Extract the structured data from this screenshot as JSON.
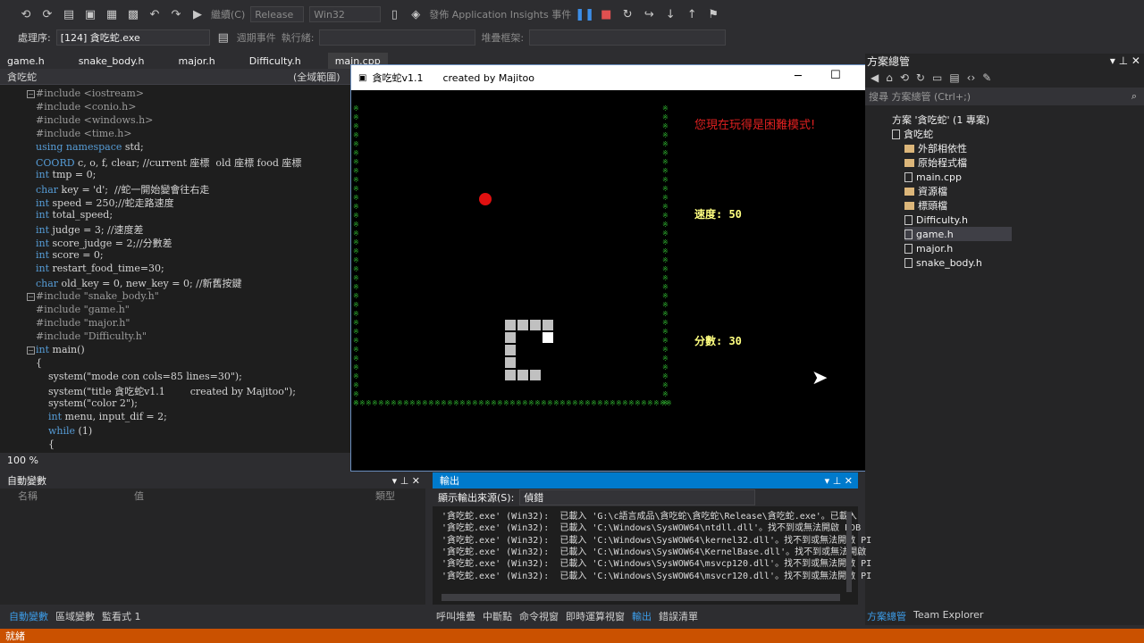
{
  "toolbar": {
    "config": "Release",
    "platform": "Win32",
    "debug_label": "繼續(C)",
    "insights_label": "發佈 Application Insights 事件"
  },
  "procbar": {
    "process_label": "處理序:",
    "process_value": "[124] 貪吃蛇.exe",
    "lifecycle_label": "週期事件",
    "thread_label": "執行緒:",
    "stack_label": "堆疊框架:"
  },
  "tabs": [
    "game.h",
    "snake_body.h",
    "major.h",
    "Difficulty.h",
    "main.cpp"
  ],
  "scope": {
    "project": "貪吃蛇",
    "scope": "(全域範圍)"
  },
  "code": [
    {
      "k": "pp",
      "t": "#include <iostream>"
    },
    {
      "k": "pp",
      "t": "#include <conio.h>"
    },
    {
      "k": "pp",
      "t": "#include <windows.h>"
    },
    {
      "k": "pp",
      "t": "#include <time.h>"
    },
    {
      "k": "mix",
      "a": "using namespace",
      "b": " std;"
    },
    {
      "k": "mix",
      "a": "COORD",
      "b": " c, o, f, clear; //current 座標  old 座標 food 座標"
    },
    {
      "k": "mix",
      "a": "int",
      "b": " tmp = 0;"
    },
    {
      "k": "mix",
      "a": "char",
      "b": " key = 'd';  //蛇一開始變會往右走"
    },
    {
      "k": "mix",
      "a": "int",
      "b": " speed = 250;//蛇走路速度"
    },
    {
      "k": "mix",
      "a": "int",
      "b": " total_speed;"
    },
    {
      "k": "mix",
      "a": "int",
      "b": " judge = 3; //速度差"
    },
    {
      "k": "mix",
      "a": "int",
      "b": " score_judge = 2;//分數差"
    },
    {
      "k": "mix",
      "a": "int",
      "b": " score = 0;"
    },
    {
      "k": "mix",
      "a": "int",
      "b": " restart_food_time=30;"
    },
    {
      "k": "mix",
      "a": "char",
      "b": " old_key = 0, new_key = 0; //新舊按鍵"
    },
    {
      "k": "pp",
      "t": "#include \"snake_body.h\""
    },
    {
      "k": "pp",
      "t": "#include \"game.h\""
    },
    {
      "k": "pp",
      "t": "#include \"major.h\""
    },
    {
      "k": "pp",
      "t": "#include \"Difficulty.h\""
    },
    {
      "k": "mix",
      "a": "int",
      "b": " main()"
    },
    {
      "k": "plain",
      "t": "{"
    },
    {
      "k": "plain",
      "t": "    system(\"mode con cols=85 lines=30\");"
    },
    {
      "k": "plain",
      "t": "    system(\"title 貪吃蛇v1.1        created by Majitoo\");"
    },
    {
      "k": "plain",
      "t": "    system(\"color 2\");"
    },
    {
      "k": "mix",
      "a": "    int",
      "b": " menu, input_dif = 2;"
    },
    {
      "k": "mix",
      "a": "    while",
      "b": " (1)"
    },
    {
      "k": "plain",
      "t": "    {"
    }
  ],
  "zoom": "100 %",
  "game": {
    "title": "貪吃蛇v1.1",
    "subtitle": "created by Majitoo",
    "mode_text": "您現在玩得是困難模式!",
    "speed_label": "速度: 50",
    "score_label": "分數: 30",
    "colors": {
      "wall": "#2eaf2e",
      "food": "#e01010",
      "mode": "#e02020",
      "stats": "#ffff80"
    }
  },
  "solexp": {
    "title": "方案總管",
    "search": "搜尋 方案總管 (Ctrl+;)",
    "solution": "方案 '貪吃蛇' (1 專案)",
    "project": "貪吃蛇",
    "items": [
      "外部相依性",
      "原始程式檔",
      "main.cpp",
      "資源檔",
      "標頭檔",
      "Difficulty.h",
      "game.h",
      "major.h",
      "snake_body.h"
    ]
  },
  "autos": {
    "title": "自動變數",
    "col_name": "名稱",
    "col_value": "值",
    "col_type": "類型"
  },
  "output": {
    "title": "輸出",
    "source_label": "顯示輸出來源(S):",
    "source_value": "偵錯",
    "lines": [
      "'貪吃蛇.exe' (Win32):  已載入 'G:\\c語言成品\\貪吃蛇\\貪吃蛇\\Release\\貪吃蛇.exe'。已載入",
      "'貪吃蛇.exe' (Win32):  已載入 'C:\\Windows\\SysWOW64\\ntdll.dll'。找不到或無法開啟 PDB",
      "'貪吃蛇.exe' (Win32):  已載入 'C:\\Windows\\SysWOW64\\kernel32.dll'。找不到或無法開啟 PI",
      "'貪吃蛇.exe' (Win32):  已載入 'C:\\Windows\\SysWOW64\\KernelBase.dll'。找不到或無法開啟",
      "'貪吃蛇.exe' (Win32):  已載入 'C:\\Windows\\SysWOW64\\msvcp120.dll'。找不到或無法開啟 PI",
      "'貪吃蛇.exe' (Win32):  已載入 'C:\\Windows\\SysWOW64\\msvcr120.dll'。找不到或無法開啟 PI"
    ]
  },
  "bottom_tabs_left": [
    "自動變數",
    "區域變數",
    "監看式 1"
  ],
  "bottom_tabs_mid": [
    "呼叫堆疊",
    "中斷點",
    "命令視窗",
    "即時運算視窗",
    "輸出",
    "錯誤清單"
  ],
  "bottom_tabs_right": [
    "方案總管",
    "Team Explorer"
  ],
  "status": "就緒"
}
